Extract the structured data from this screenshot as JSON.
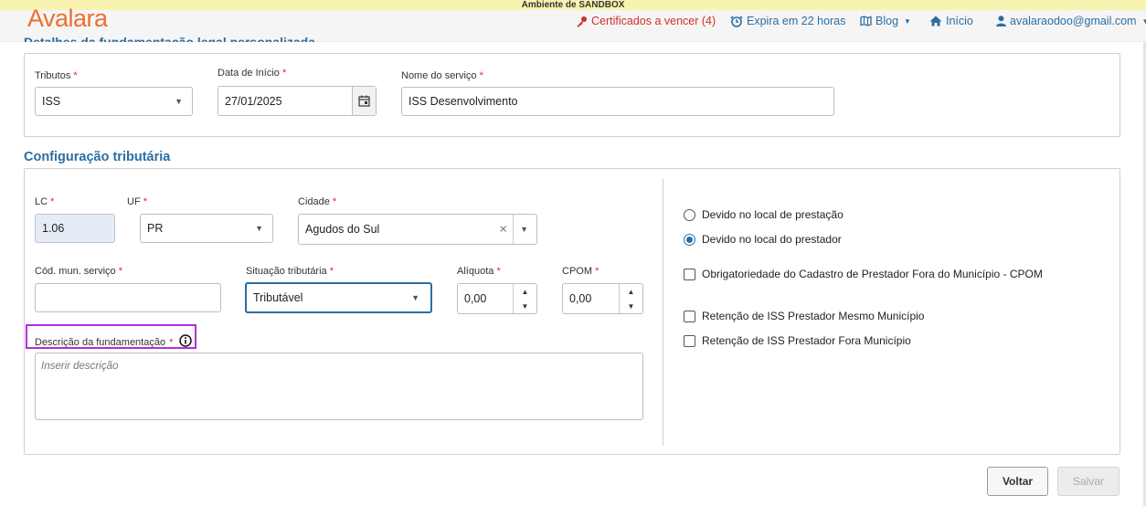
{
  "sandbox": {
    "text": "Ambiente de SANDBOX"
  },
  "header": {
    "logo": "Avalara",
    "certs": "Certificados a vencer (4)",
    "expires": "Expira em 22 horas",
    "blog": "Blog",
    "home": "Início",
    "user": "avalaraodoo@gmail.com"
  },
  "section1": {
    "title": "Detalhes da fundamentação legal personalizada",
    "tributos": {
      "label": "Tributos",
      "value": "ISS"
    },
    "data_inicio": {
      "label": "Data de Início",
      "value": "27/01/2025"
    },
    "nome_servico": {
      "label": "Nome do serviço",
      "value": "ISS Desenvolvimento"
    }
  },
  "section2": {
    "title": "Configuração tributária",
    "lc": {
      "label": "LC",
      "value": "1.06"
    },
    "uf": {
      "label": "UF",
      "value": "PR"
    },
    "cidade": {
      "label": "Cidade",
      "value": "Agudos do Sul"
    },
    "cod_mun": {
      "label": "Cód. mun. serviço",
      "value": ""
    },
    "situacao": {
      "label": "Situação tributária",
      "value": "Tributável"
    },
    "aliquota": {
      "label": "Alíquota",
      "value": "0,00"
    },
    "cpom": {
      "label": "CPOM",
      "value": "0,00"
    },
    "descricao": {
      "label": "Descrição da fundamentação",
      "placeholder": "Inserir descrição"
    },
    "options": {
      "radio_prestacao": "Devido no local de prestação",
      "radio_prestador": "Devido no local do prestador",
      "check_cpom": "Obrigatoriedade do Cadastro de Prestador Fora do Município - CPOM",
      "check_mesmo": "Retenção de ISS Prestador Mesmo Município",
      "check_fora": "Retenção de ISS Prestador Fora Município"
    }
  },
  "buttons": {
    "voltar": "Voltar",
    "salvar": "Salvar"
  },
  "required_mark": "*",
  "colors": {
    "brand": "#ef6e2e",
    "link": "#2c6ea3",
    "warning": "#d0302b",
    "highlight": "#b12ee0"
  }
}
